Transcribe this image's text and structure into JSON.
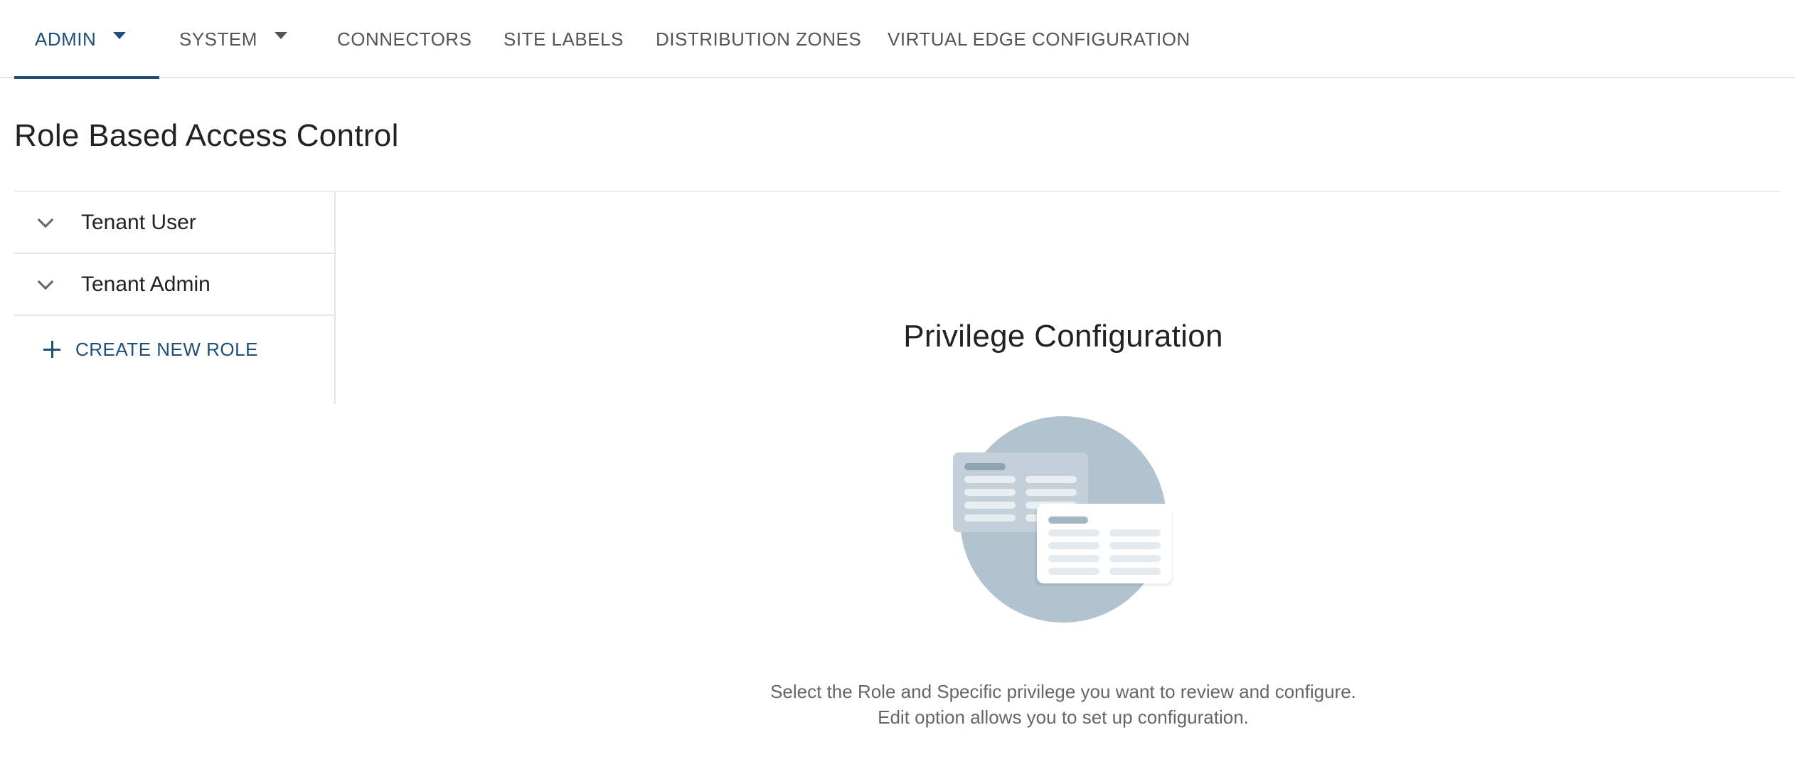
{
  "nav": {
    "tabs": [
      {
        "label": "ADMIN",
        "has_dropdown": true,
        "active": true
      },
      {
        "label": "SYSTEM",
        "has_dropdown": true,
        "active": false
      },
      {
        "label": "CONNECTORS",
        "has_dropdown": false,
        "active": false
      },
      {
        "label": "SITE LABELS",
        "has_dropdown": false,
        "active": false
      },
      {
        "label": "DISTRIBUTION ZONES",
        "has_dropdown": false,
        "active": false
      },
      {
        "label": "VIRTUAL EDGE CONFIGURATION",
        "has_dropdown": false,
        "active": false
      }
    ]
  },
  "page": {
    "title": "Role Based Access Control"
  },
  "roles": {
    "items": [
      {
        "label": "Tenant User",
        "icon": "chevron-down-icon"
      },
      {
        "label": "Tenant Admin",
        "icon": "chevron-down-icon"
      }
    ],
    "create_label": "CREATE NEW ROLE",
    "create_icon": "plus-icon"
  },
  "privilege": {
    "title": "Privilege Configuration",
    "illustration_icon": "config-cards-illustration",
    "help_line1": "Select the Role and Specific privilege you want to review and configure.",
    "help_line2": "Edit option allows you to set up configuration."
  },
  "colors": {
    "accent": "#1d4f7a",
    "illustration_circle": "#b0c3ce"
  }
}
